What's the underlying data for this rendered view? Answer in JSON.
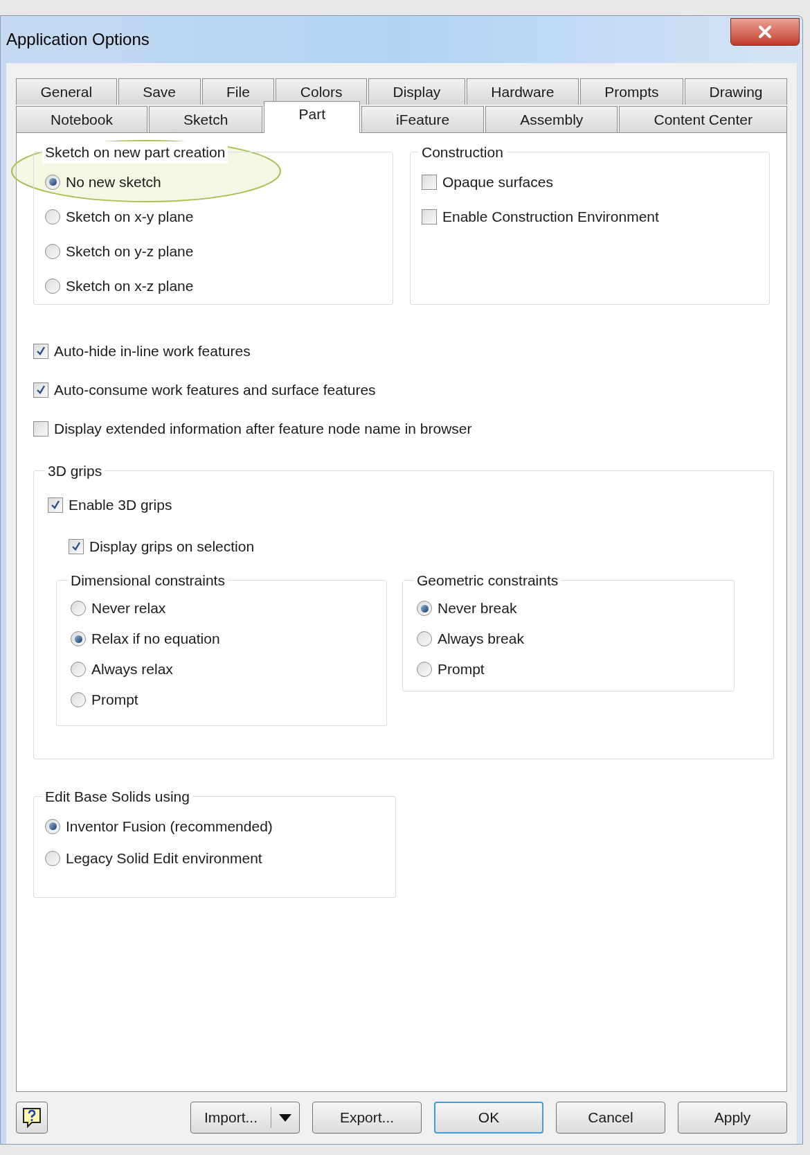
{
  "window": {
    "title": "Application Options"
  },
  "tabs": [
    [
      {
        "label": "General",
        "selected": false
      },
      {
        "label": "Save",
        "selected": false
      },
      {
        "label": "File",
        "selected": false
      },
      {
        "label": "Colors",
        "selected": false
      },
      {
        "label": "Display",
        "selected": false
      },
      {
        "label": "Hardware",
        "selected": false
      },
      {
        "label": "Prompts",
        "selected": false
      },
      {
        "label": "Drawing",
        "selected": false
      }
    ],
    [
      {
        "label": "Notebook",
        "selected": false
      },
      {
        "label": "Sketch",
        "selected": false
      },
      {
        "label": "Part",
        "selected": true
      },
      {
        "label": "iFeature",
        "selected": false
      },
      {
        "label": "Assembly",
        "selected": false
      },
      {
        "label": "Content Center",
        "selected": false
      }
    ]
  ],
  "sketch_group": {
    "title": "Sketch on new part creation",
    "highlighted": true,
    "options": [
      {
        "label": "No new sketch",
        "selected": true
      },
      {
        "label": "Sketch on x-y plane",
        "selected": false
      },
      {
        "label": "Sketch on y-z plane",
        "selected": false
      },
      {
        "label": "Sketch on x-z plane",
        "selected": false
      }
    ]
  },
  "construction": {
    "title": "Construction",
    "options": [
      {
        "label": "Opaque surfaces",
        "checked": false
      },
      {
        "label": "Enable Construction Environment",
        "checked": false
      }
    ]
  },
  "checkboxes": [
    {
      "label": "Auto-hide in-line work features",
      "checked": true
    },
    {
      "label": "Auto-consume work features and surface features",
      "checked": true
    },
    {
      "label": "Display extended information after feature node name in browser",
      "checked": false
    }
  ],
  "grips": {
    "title": "3D grips",
    "enable": {
      "label": "Enable 3D grips",
      "checked": true
    },
    "display": {
      "label": "Display grips on selection",
      "checked": true
    },
    "dimensional": {
      "title": "Dimensional constraints",
      "options": [
        {
          "label": "Never relax",
          "selected": false
        },
        {
          "label": "Relax if no equation",
          "selected": true
        },
        {
          "label": "Always relax",
          "selected": false
        },
        {
          "label": "Prompt",
          "selected": false
        }
      ]
    },
    "geometric": {
      "title": "Geometric constraints",
      "options": [
        {
          "label": "Never break",
          "selected": true
        },
        {
          "label": "Always break",
          "selected": false
        },
        {
          "label": "Prompt",
          "selected": false
        }
      ]
    }
  },
  "edit_base": {
    "title": "Edit Base Solids using",
    "options": [
      {
        "label": "Inventor Fusion (recommended)",
        "selected": true
      },
      {
        "label": "Legacy Solid Edit environment",
        "selected": false
      }
    ]
  },
  "buttons": [
    {
      "label": "Import...",
      "kind": "split",
      "default": false
    },
    {
      "label": "Export...",
      "kind": "plain",
      "default": false
    },
    {
      "label": "OK",
      "kind": "plain",
      "default": true
    },
    {
      "label": "Cancel",
      "kind": "plain",
      "default": false
    },
    {
      "label": "Apply",
      "kind": "plain",
      "default": false
    }
  ]
}
